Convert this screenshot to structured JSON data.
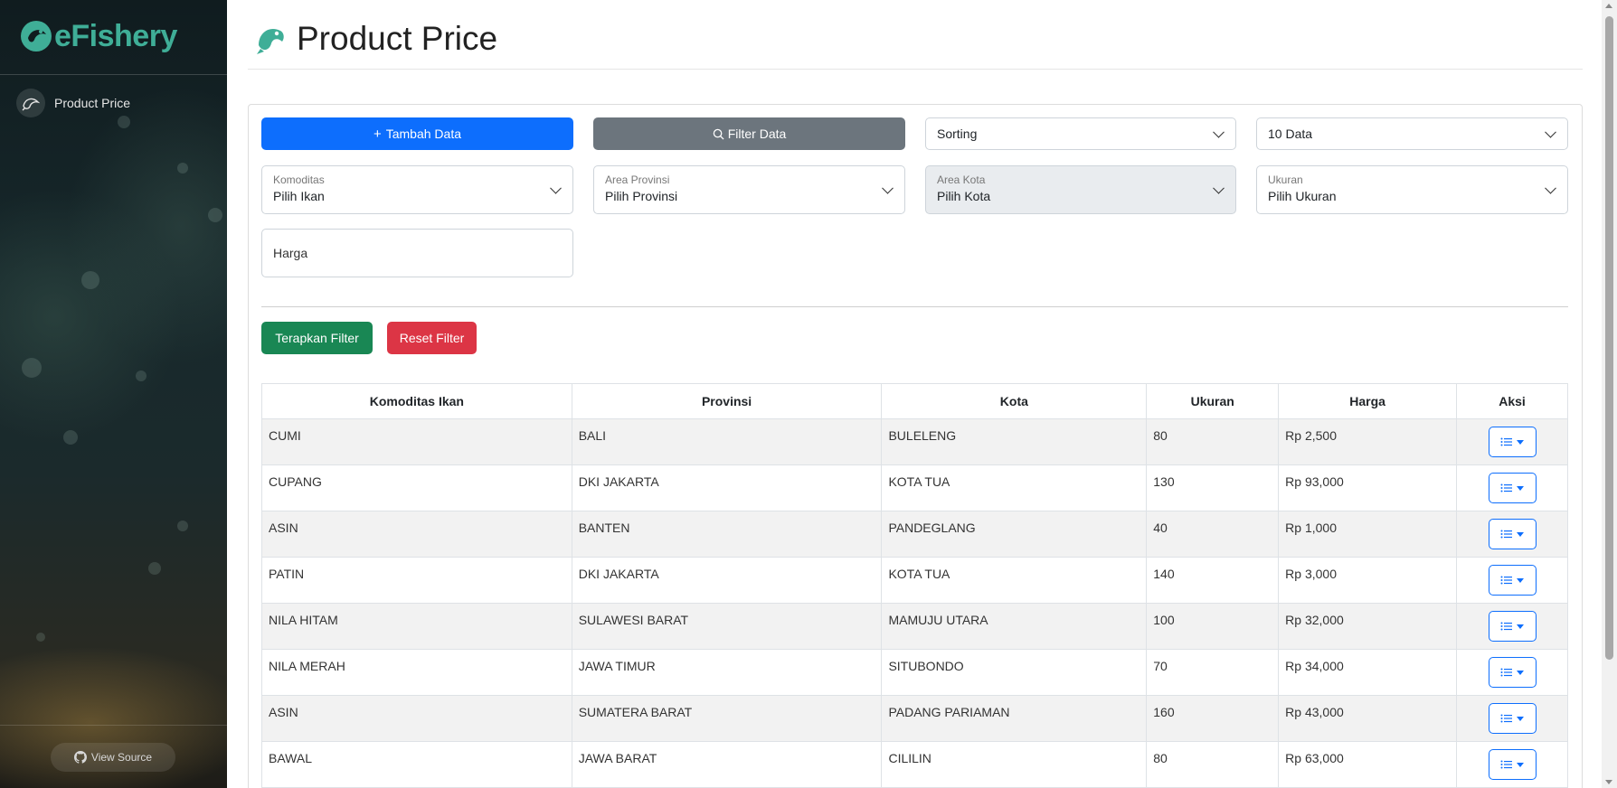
{
  "brand": {
    "name": "eFishery",
    "color": "#3fae97"
  },
  "sidebar": {
    "items": [
      {
        "label": "Product Price",
        "icon": "fish-icon"
      }
    ],
    "view_source": "View Source"
  },
  "header": {
    "title": "Product Price",
    "icon": "fish-icon"
  },
  "toolbar": {
    "add_label": "Tambah Data",
    "filter_label": "Filter Data",
    "sorting_value": "Sorting",
    "page_size_value": "10 Data"
  },
  "filters": {
    "komoditas": {
      "label": "Komoditas",
      "value": "Pilih Ikan"
    },
    "provinsi": {
      "label": "Area Provinsi",
      "value": "Pilih Provinsi"
    },
    "kota": {
      "label": "Area Kota",
      "value": "Pilih Kota"
    },
    "ukuran": {
      "label": "Ukuran",
      "value": "Pilih Ukuran"
    },
    "harga_placeholder": "Harga",
    "apply_label": "Terapkan Filter",
    "reset_label": "Reset Filter"
  },
  "table": {
    "headers": [
      "Komoditas Ikan",
      "Provinsi",
      "Kota",
      "Ukuran",
      "Harga",
      "Aksi"
    ],
    "rows": [
      [
        "CUMI",
        "BALI",
        "BULELENG",
        "80",
        "Rp 2,500"
      ],
      [
        "CUPANG",
        "DKI JAKARTA",
        "KOTA TUA",
        "130",
        "Rp 93,000"
      ],
      [
        "ASIN",
        "BANTEN",
        "PANDEGLANG",
        "40",
        "Rp 1,000"
      ],
      [
        "PATIN",
        "DKI JAKARTA",
        "KOTA TUA",
        "140",
        "Rp 3,000"
      ],
      [
        "NILA HITAM",
        "SULAWESI BARAT",
        "MAMUJU UTARA",
        "100",
        "Rp 32,000"
      ],
      [
        "NILA MERAH",
        "JAWA TIMUR",
        "SITUBONDO",
        "70",
        "Rp 34,000"
      ],
      [
        "ASIN",
        "SUMATERA BARAT",
        "PADANG PARIAMAN",
        "160",
        "Rp 43,000"
      ],
      [
        "BAWAL",
        "JAWA BARAT",
        "CILILIN",
        "80",
        "Rp 63,000"
      ]
    ]
  },
  "colors": {
    "primary": "#0d6efd",
    "secondary": "#6c757d",
    "success": "#198754",
    "danger": "#dc3545"
  }
}
